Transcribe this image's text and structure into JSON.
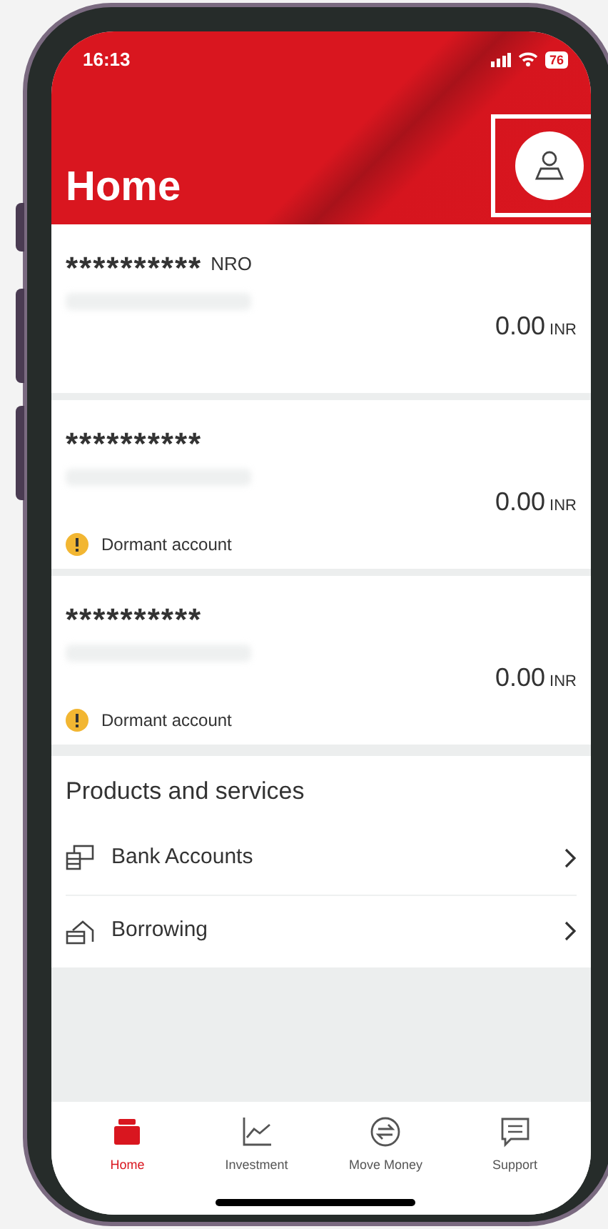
{
  "status_bar": {
    "time": "16:13",
    "battery": "76"
  },
  "header": {
    "title": "Home"
  },
  "accounts": [
    {
      "number": "**********",
      "type": "NRO",
      "balance": "0.00",
      "currency": "INR",
      "dormant": false
    },
    {
      "number": "**********",
      "balance": "0.00",
      "currency": "INR",
      "dormant": true,
      "notice": "Dormant account"
    },
    {
      "number": "**********",
      "balance": "0.00",
      "currency": "INR",
      "dormant": true,
      "notice": "Dormant account"
    }
  ],
  "products": {
    "title": "Products and services",
    "items": [
      {
        "label": "Bank Accounts"
      },
      {
        "label": "Borrowing"
      }
    ]
  },
  "tabs": [
    {
      "label": "Home",
      "selected": true
    },
    {
      "label": "Investment",
      "selected": false
    },
    {
      "label": "Move Money",
      "selected": false
    },
    {
      "label": "Support",
      "selected": false
    }
  ]
}
